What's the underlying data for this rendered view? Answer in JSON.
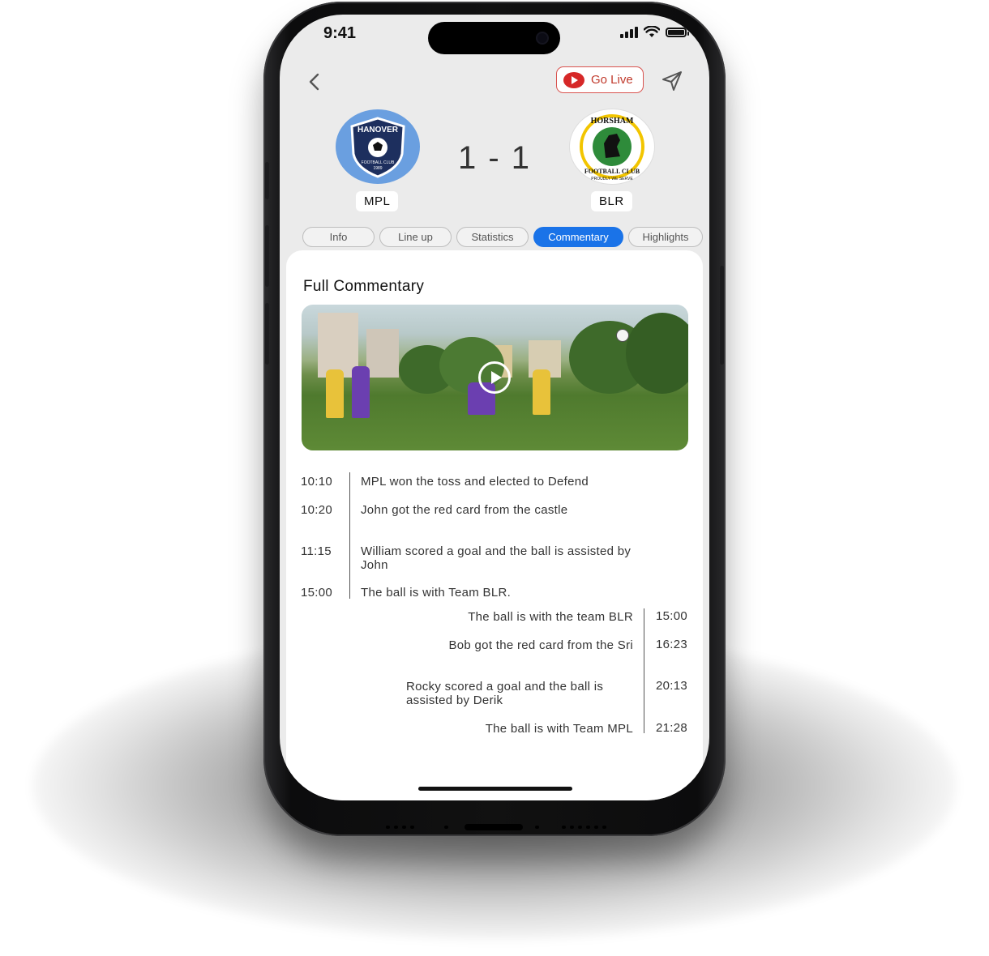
{
  "status_bar": {
    "time": "9:41"
  },
  "header": {
    "go_live_label": "Go Live",
    "icons": [
      "back-chevron-icon",
      "youtube-play-icon",
      "send-icon"
    ]
  },
  "match": {
    "home": {
      "name": "MPL",
      "logo_text": "HANOVER",
      "logo_sub": "FOOTBALL CLUB",
      "logo_year": "1989"
    },
    "away": {
      "name": "BLR",
      "logo_text": "HORSHAM",
      "logo_sub": "FOOTBALL CLUB",
      "logo_motto": "PROUDLY WE SERVE"
    },
    "score": "1 - 1"
  },
  "tabs": [
    {
      "label": "Info",
      "active": false
    },
    {
      "label": "Line up",
      "active": false
    },
    {
      "label": "Statistics",
      "active": false
    },
    {
      "label": "Commentary",
      "active": true
    },
    {
      "label": "Highlights",
      "active": false
    }
  ],
  "commentary": {
    "title": "Full Commentary",
    "home_events": [
      {
        "time": "10:10",
        "text": "MPL won the toss and elected to Defend"
      },
      {
        "time": "10:20",
        "text": "John got the red card from the castle"
      },
      {
        "time": "11:15",
        "text": "William scored a goal and the ball is assisted by John"
      },
      {
        "time": "15:00",
        "text": "The ball is with Team BLR."
      }
    ],
    "away_events": [
      {
        "time": "15:00",
        "text": "The ball is with the team BLR"
      },
      {
        "time": "16:23",
        "text": "Bob got the red card from the Sri"
      },
      {
        "time": "20:13",
        "text": "Rocky scored a goal and the ball is assisted by Derik"
      },
      {
        "time": "21:28",
        "text": "The ball is with Team MPL"
      }
    ]
  },
  "colors": {
    "accent_blue": "#1a73e8",
    "live_red": "#d62828",
    "home_logo_bg": "#6a9fe0",
    "screen_bg": "#ebebeb"
  }
}
